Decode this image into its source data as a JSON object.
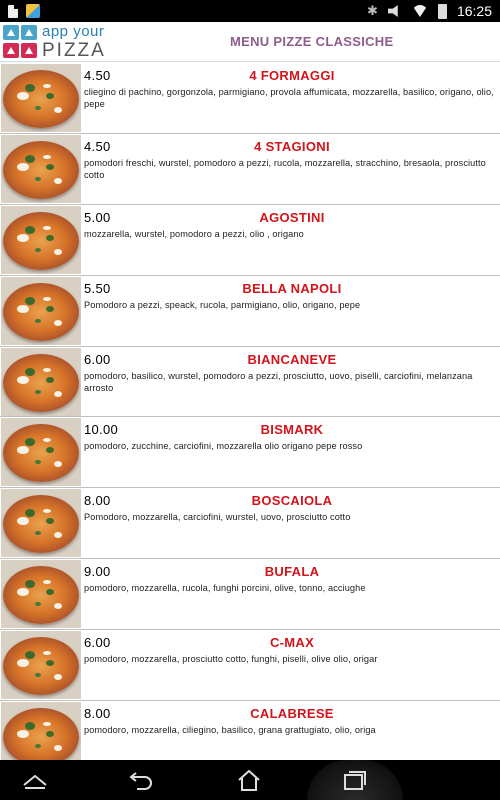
{
  "status_bar": {
    "time": "16:25",
    "icons": [
      "document-icon",
      "cleaner-icon",
      "bluetooth-icon",
      "mute-icon",
      "wifi-icon",
      "battery-icon"
    ]
  },
  "header": {
    "logo_top": "app your",
    "logo_bottom": "PIZZA",
    "title": "MENU PIZZE CLASSICHE"
  },
  "pizzas": [
    {
      "price": "4.50",
      "name": "4 FORMAGGI",
      "description": "cliegino di pachino, gorgonzola, parmigiano, provola affumicata,  mozzarella, basilico, origano, olio, pepe"
    },
    {
      "price": "4.50",
      "name": "4 STAGIONI",
      "description": "pomodori freschi,  wurstel, pomodoro a pezzi, rucola, mozzarella, stracchino, bresaola, prosciutto cotto"
    },
    {
      "price": "5.00",
      "name": "AGOSTINI",
      "description": "mozzarella, wurstel, pomodoro a pezzi, olio , origano"
    },
    {
      "price": "5.50",
      "name": "BELLA NAPOLI",
      "description": "Pomodoro a pezzi, speack, rucola, parmigiano, olio, origano, pepe"
    },
    {
      "price": "6.00",
      "name": "BIANCANEVE",
      "description": "pomodoro, basilico,  wurstel, pomodoro a pezzi, prosciutto, uovo, piselli, carciofini, melanzana arrosto"
    },
    {
      "price": "10.00",
      "name": "BISMARK",
      "description": "pomodoro, zucchine, carciofini, mozzarella olio origano pepe rosso"
    },
    {
      "price": "8.00",
      "name": "BOSCAIOLA",
      "description": "Pomodoro, mozzarella, carciofini, wurstel, uovo, prosciutto cotto"
    },
    {
      "price": "9.00",
      "name": "BUFALA",
      "description": "pomodoro, mozzarella, rucola, funghi porcini, olive, tonno, acciughe"
    },
    {
      "price": "6.00",
      "name": "C-MAX",
      "description": "pomodoro, mozzarella, prosciutto cotto, funghi, piselli, olive olio, origar"
    },
    {
      "price": "8.00",
      "name": "CALABRESE",
      "description": "pomodoro, mozzarella, ciliegino, basilico, grana grattugiato, olio, origa"
    }
  ],
  "nav_bar": {
    "buttons": [
      "up-icon",
      "back-icon",
      "home-icon",
      "recent-apps-icon"
    ]
  },
  "colors": {
    "title": "#8d5d8b",
    "pizza_name": "#d2141c",
    "logo_app": "#2b7fb3",
    "logo_icon_blue": "#4aa4c8",
    "logo_icon_red": "#d42b55"
  }
}
